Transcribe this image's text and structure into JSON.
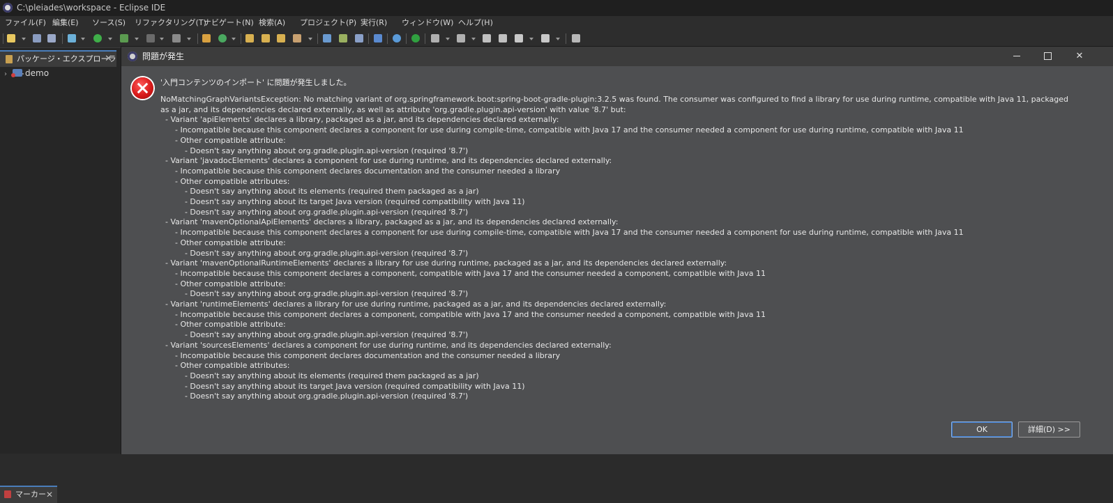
{
  "window": {
    "title": "C:\\pleiades\\workspace - Eclipse IDE"
  },
  "menu": [
    "ファイル(F)",
    "編集(E)",
    "ソース(S)",
    "リファクタリング(T)",
    "ナビゲート(N)",
    "検索(A)",
    "プロジェクト(P)",
    "実行(R)",
    "ウィンドウ(W)",
    "ヘルプ(H)"
  ],
  "package_explorer": {
    "tab_label": "パッケージ・エクスプローラー",
    "close": "✕",
    "tree": [
      {
        "label": "demo",
        "expander": "›"
      }
    ]
  },
  "markers_tab": {
    "label": "マーカー",
    "close": "✕"
  },
  "dialog": {
    "title": "問題が発生",
    "window_controls": {
      "close": "✕"
    },
    "heading": "'入門コンテンツのインポート' に問題が発生しました。",
    "first_line": "NoMatchingGraphVariantsException: No matching variant of org.springframework.boot:spring-boot-gradle-plugin:3.2.5 was found. The consumer was configured to find a library for use during runtime, compatible with Java 11, packaged as a jar, and its dependencies declared externally, as well as attribute 'org.gradle.plugin.api-version' with value '8.7' but:",
    "lines": [
      "  - Variant 'apiElements' declares a library, packaged as a jar, and its dependencies declared externally:",
      "      - Incompatible because this component declares a component for use during compile-time, compatible with Java 17 and the consumer needed a component for use during runtime, compatible with Java 11",
      "      - Other compatible attribute:",
      "          - Doesn't say anything about org.gradle.plugin.api-version (required '8.7')",
      "  - Variant 'javadocElements' declares a component for use during runtime, and its dependencies declared externally:",
      "      - Incompatible because this component declares documentation and the consumer needed a library",
      "      - Other compatible attributes:",
      "          - Doesn't say anything about its elements (required them packaged as a jar)",
      "          - Doesn't say anything about its target Java version (required compatibility with Java 11)",
      "          - Doesn't say anything about org.gradle.plugin.api-version (required '8.7')",
      "  - Variant 'mavenOptionalApiElements' declares a library, packaged as a jar, and its dependencies declared externally:",
      "      - Incompatible because this component declares a component for use during compile-time, compatible with Java 17 and the consumer needed a component for use during runtime, compatible with Java 11",
      "      - Other compatible attribute:",
      "          - Doesn't say anything about org.gradle.plugin.api-version (required '8.7')",
      "  - Variant 'mavenOptionalRuntimeElements' declares a library for use during runtime, packaged as a jar, and its dependencies declared externally:",
      "      - Incompatible because this component declares a component, compatible with Java 17 and the consumer needed a component, compatible with Java 11",
      "      - Other compatible attribute:",
      "          - Doesn't say anything about org.gradle.plugin.api-version (required '8.7')",
      "  - Variant 'runtimeElements' declares a library for use during runtime, packaged as a jar, and its dependencies declared externally:",
      "      - Incompatible because this component declares a component, compatible with Java 17 and the consumer needed a component, compatible with Java 11",
      "      - Other compatible attribute:",
      "          - Doesn't say anything about org.gradle.plugin.api-version (required '8.7')",
      "  - Variant 'sourcesElements' declares a component for use during runtime, and its dependencies declared externally:",
      "      - Incompatible because this component declares documentation and the consumer needed a library",
      "      - Other compatible attributes:",
      "          - Doesn't say anything about its elements (required them packaged as a jar)",
      "          - Doesn't say anything about its target Java version (required compatibility with Java 11)",
      "          - Doesn't say anything about org.gradle.plugin.api-version (required '8.7')"
    ],
    "buttons": {
      "ok": "OK",
      "details": "詳細(D) >>"
    }
  },
  "colors": {
    "accent": "#4a7ebb",
    "error": "#d81a1a",
    "dialog_bg": "#4e4f51"
  }
}
